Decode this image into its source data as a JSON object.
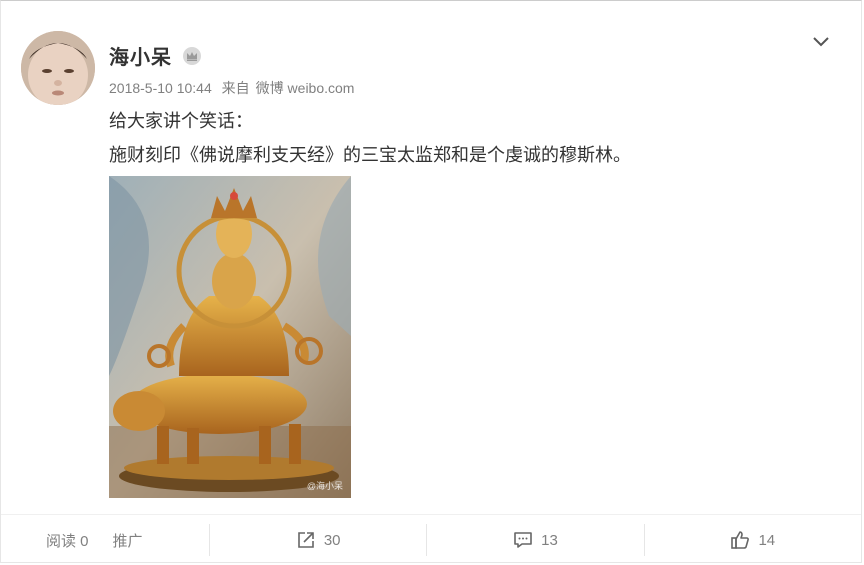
{
  "post": {
    "username": "海小呆",
    "meta": {
      "timestamp": "2018-5-10 10:44",
      "from_label": "来自",
      "source": "微博 weibo.com"
    },
    "text_line1": "给大家讲个笑话：",
    "text_line2": "施财刻印《佛说摩利支天经》的三宝太监郑和是个虔诚的穆斯林。",
    "image_watermark": "@海小呆"
  },
  "footer": {
    "read_label": "阅读 0",
    "promote_label": "推广",
    "share_count": "30",
    "comment_count": "13",
    "like_count": "14"
  },
  "icons": {
    "vip": "crown-badge-icon",
    "menu": "chevron-down-icon",
    "share": "share-icon",
    "comment": "comment-icon",
    "like": "thumbs-up-icon"
  }
}
